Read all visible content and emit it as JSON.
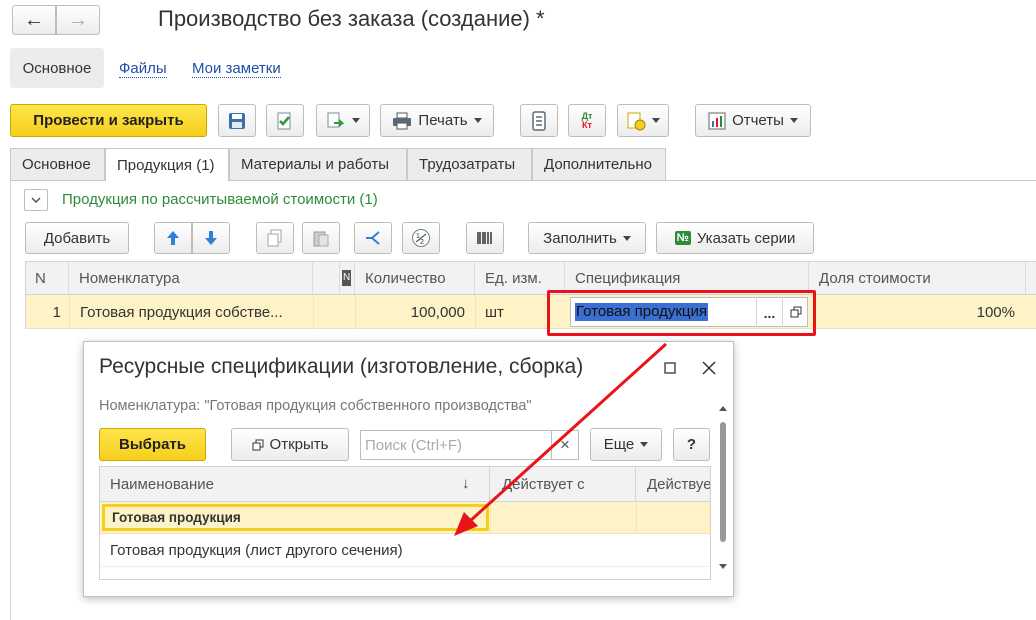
{
  "window": {
    "title": "Производство без заказа (создание) *"
  },
  "nav": {
    "back_glyph": "←",
    "forward_glyph": "→"
  },
  "section_tabs": [
    {
      "label": "Основное"
    },
    {
      "label": "Файлы"
    },
    {
      "label": "Мои заметки"
    }
  ],
  "toolbar": {
    "post_close": "Провести и закрыть",
    "print": "Печать",
    "reports": "Отчеты",
    "dtkt_top": "Дт",
    "dtkt_bottom": "Кт"
  },
  "tabs": [
    {
      "label": "Основное"
    },
    {
      "label": "Продукция (1)"
    },
    {
      "label": "Материалы и работы"
    },
    {
      "label": "Трудозатраты"
    },
    {
      "label": "Дополнительно"
    }
  ],
  "group": {
    "toggle_glyph": "⌄",
    "title": "Продукция по рассчитываемой стоимости (1)"
  },
  "table_toolbar": {
    "add": "Добавить",
    "fill": "Заполнить",
    "series_icon": "№",
    "series": "Указать серии"
  },
  "table": {
    "columns": [
      "N",
      "Номенклатура",
      "N",
      "Количество",
      "Ед. изм.",
      "Спецификация",
      "Доля стоимости"
    ],
    "rows": [
      {
        "n": "1",
        "item": "Готовая продукция собстве...",
        "qty": "100,000",
        "unit": "шт",
        "spec": "Готовая продукция",
        "choose": "...",
        "share": "100%"
      }
    ]
  },
  "dialog": {
    "title": "Ресурсные спецификации (изготовление, сборка)",
    "filter": "Номенклатура: \"Готовая продукция собственного производства\"",
    "select": "Выбрать",
    "open": "Открыть",
    "search_placeholder": "Поиск (Ctrl+F)",
    "clear": "×",
    "more": "Еще",
    "help": "?",
    "maximize_glyph": "☐",
    "close_glyph": "✕",
    "columns": [
      "Наименование",
      "Действует с",
      "Действуе"
    ],
    "sort_glyph": "↓",
    "rows": [
      {
        "name": "Готовая продукция"
      },
      {
        "name": "Готовая продукция (лист другого сечения)"
      }
    ]
  },
  "colors": {
    "accent_yellow": "#f5cf1c",
    "selected_row": "#fdf3c6",
    "link_blue": "#1f4fa8",
    "group_green": "#2e8b3a",
    "annotation_red": "#e8141a"
  }
}
